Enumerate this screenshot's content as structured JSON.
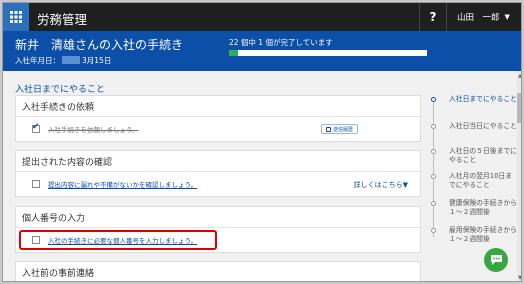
{
  "app": {
    "title": "労務管理",
    "help_label": "?",
    "user_name": "山田　一郎",
    "user_caret": "▼"
  },
  "header": {
    "title": "新井　清雄さんの入社の手続き",
    "hire_date_label": "入社年月日：",
    "hire_date_suffix": "3月15日",
    "progress_text": "22 個中 1 個が完了しています",
    "progress_completed": 1,
    "progress_total": 22
  },
  "main": {
    "section_title": "入社日までにやること",
    "cards": [
      {
        "title": "入社手続きの依頼",
        "task": "入社手続きを依頼しましょう。",
        "checked": true,
        "button": "送信履歴"
      },
      {
        "title": "提出された内容の確認",
        "task": "提出内容に漏れや不備がないかを確認しましょう。",
        "checked": false,
        "more": "詳しくはこちら▼"
      },
      {
        "title": "個人番号の入力",
        "task": "入社の手続きに必要な個人番号を入力しましょう。",
        "checked": false
      },
      {
        "title": "入社前の事前連絡"
      }
    ]
  },
  "timeline": [
    {
      "label": "入社日までにやること",
      "active": true
    },
    {
      "label": "入社日当日にやること",
      "active": false
    },
    {
      "label": "入社日の５日後までにやること",
      "active": false
    },
    {
      "label": "入社月の翌月10日までにやること",
      "active": false
    },
    {
      "label": "健康保険の手続きから１～２週間後",
      "active": false
    },
    {
      "label": "雇用保険の手続きから１～２週間後",
      "active": false
    }
  ],
  "colors": {
    "topbar": "#1f1f1f",
    "header": "#0b4fa8",
    "progress": "#2dae56",
    "highlight": "#e00000",
    "chat": "#3aa641"
  },
  "icons": {
    "grid": "apps-grid-icon",
    "chat": "chat-icon",
    "history": "clipboard-icon"
  }
}
